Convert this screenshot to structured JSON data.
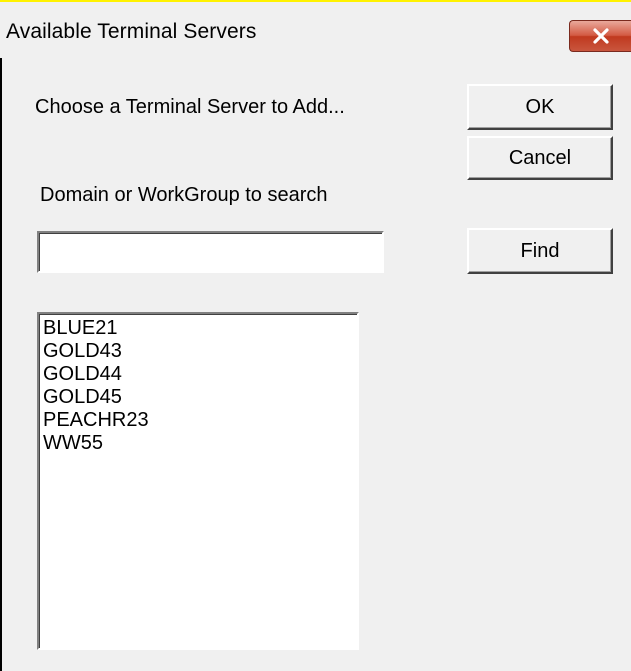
{
  "window": {
    "title": "Available Terminal Servers",
    "close_icon": "close-icon"
  },
  "dialog": {
    "prompt": "Choose a Terminal Server to Add...",
    "ok_label": "OK",
    "cancel_label": "Cancel",
    "domain_label": "Domain or WorkGroup to search",
    "domain_value": "",
    "find_label": "Find"
  },
  "servers": {
    "items": [
      "BLUE21",
      "GOLD43",
      "GOLD44",
      "GOLD45",
      "PEACHR23",
      "WW55"
    ]
  }
}
